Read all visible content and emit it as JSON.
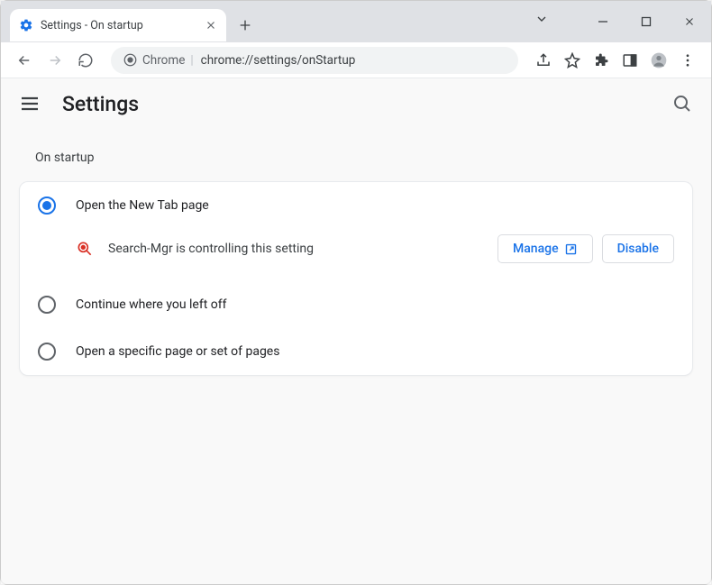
{
  "tab": {
    "title": "Settings - On startup"
  },
  "address": {
    "scheme_label": "Chrome",
    "path": "chrome://settings/onStartup"
  },
  "header": {
    "title": "Settings"
  },
  "section": {
    "title": "On startup"
  },
  "options": [
    {
      "label": "Open the New Tab page",
      "selected": true
    },
    {
      "label": "Continue where you left off",
      "selected": false
    },
    {
      "label": "Open a specific page or set of pages",
      "selected": false
    }
  ],
  "warning": {
    "text": "Search-Mgr is controlling this setting",
    "manage": "Manage",
    "disable": "Disable"
  }
}
